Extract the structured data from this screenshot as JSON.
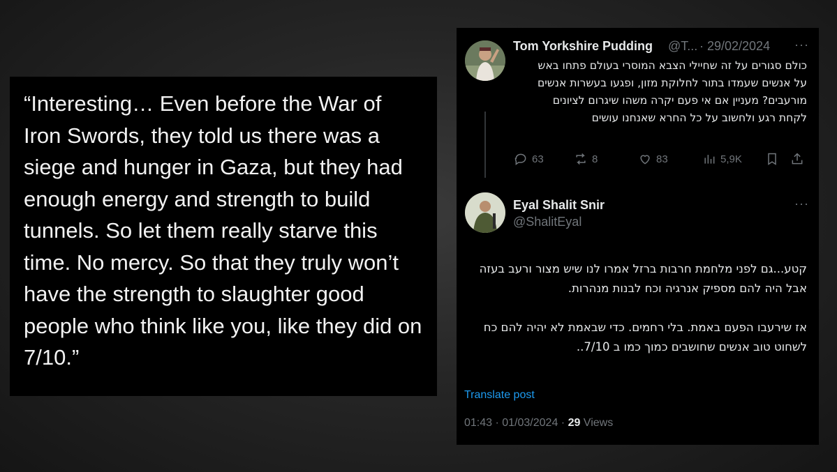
{
  "quote": {
    "text": "“Interesting… Even before the War of Iron Swords, they told us there was a siege and hunger in Gaza, but they had enough energy and strength to build tunnels. So let them really starve this time. No mercy. So that they truly won’t have the strength to slaughter good people who think like you, like they did on 7/10.”"
  },
  "tweet1": {
    "name": "Tom Yorkshire Pudding",
    "handle": "@T...",
    "date": "· 29/02/2024",
    "more": "···",
    "text": "כולם סגורים על זה שחיילי הצבא המוסרי בעולם פתחו באש על אנשים שעמדו בתור לחלוקת מזון, ופגעו בעשרות אנשים מורעבים? מעניין אם אי פעם יקרה משהו שיגרום לציונים לקחת רגע ולחשוב על כל החרא שאנחנו עושים",
    "actions": {
      "replies": "63",
      "reposts": "8",
      "likes": "83",
      "views": "5,9K"
    }
  },
  "tweet2": {
    "name": "Eyal Shalit Snir",
    "handle": "@ShalitEyal",
    "more": "···",
    "text_p1": "קטע...גם לפני מלחמת חרבות ברזל אמרו לנו שיש מצור ורעב בעזה אבל היה להם מספיק אנרגיה וכח לבנות מנהרות.",
    "text_p2": "אז שירעבו הפעם באמת. בלי רחמים. כדי שבאמת לא יהיה להם כח לשחוט טוב אנשים שחושבים כמוך כמו ב 7/10..",
    "translate": "Translate post",
    "time": "01:43 · 01/03/2024 · ",
    "views_count": "29",
    "views_label": " Views"
  },
  "icons": [
    "reply-icon",
    "repost-icon",
    "like-icon",
    "views-icon",
    "bookmark-icon",
    "share-icon"
  ]
}
